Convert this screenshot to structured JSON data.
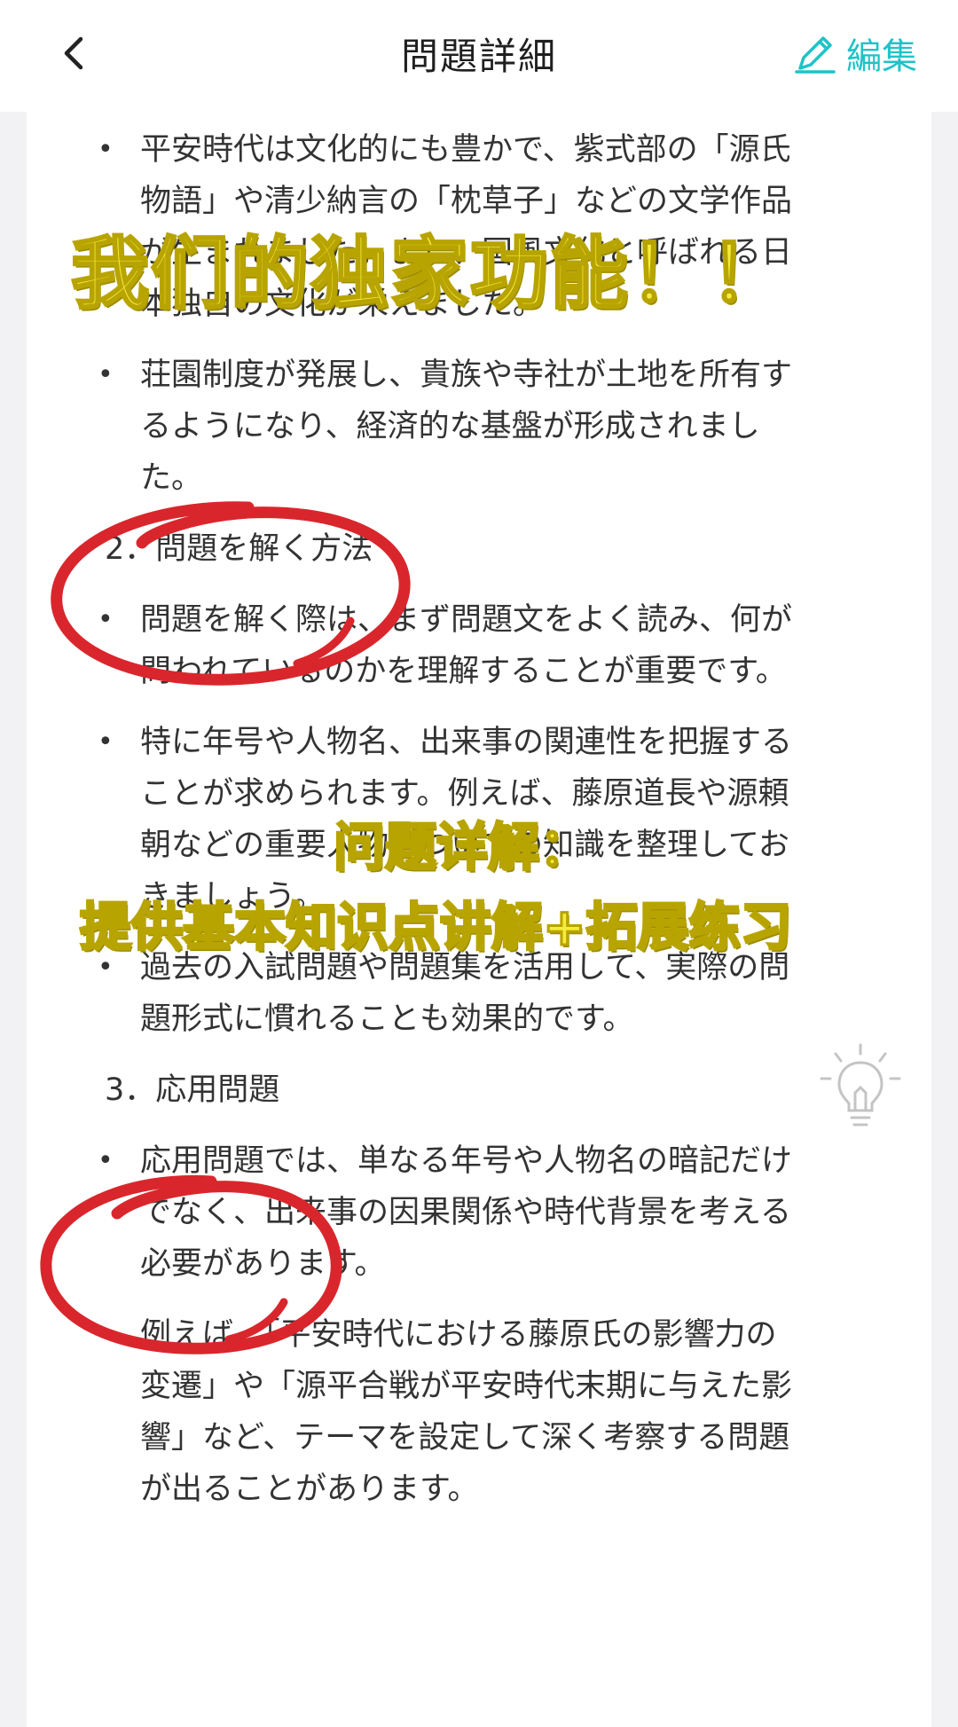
{
  "header": {
    "title": "問題詳細",
    "edit_label": "編集"
  },
  "content": {
    "section1_bullets": [
      "平安時代は文化的にも豊かで、紫式部の「源氏物語」や清少納言の「枕草子」などの文学作品が生まれました。また、国風文化と呼ばれる日本独自の文化が栄えました。",
      "荘園制度が発展し、貴族や寺社が土地を所有するようになり、経済的な基盤が形成されました。"
    ],
    "section2_heading": "2．問題を解く方法",
    "section2_bullets": [
      "問題を解く際は、まず問題文をよく読み、何が問われているのかを理解することが重要です。",
      "特に年号や人物名、出来事の関連性を把握することが求められます。例えば、藤原道長や源頼朝などの重要人物についての知識を整理しておきましょう。",
      "過去の入試問題や問題集を活用して、実際の問題形式に慣れることも効果的です。"
    ],
    "section3_heading": "3．応用問題",
    "section3_bullets": [
      "応用問題では、単なる年号や人物名の暗記だけでなく、出来事の因果関係や時代背景を考える必要があります。",
      "例えば、「平安時代における藤原氏の影響力の変遷」や「源平合戦が平安時代末期に与えた影響」など、テーマを設定して深く考察する問題が出ることがあります。"
    ],
    "bullet_symbol": "•"
  },
  "overlays": {
    "headline": "我们的独家功能！！",
    "caption_line1": "问题详解：",
    "caption_line2": "提供基本知识点讲解+拓展练习"
  },
  "icons": {
    "back": "chevron-left-icon",
    "edit": "pencil-icon",
    "hint": "lightbulb-icon"
  },
  "colors": {
    "accent": "#1ec3c8",
    "annotation_red": "#d9262c",
    "overlay_yellow": "#f6ec3d",
    "text": "#333333"
  }
}
